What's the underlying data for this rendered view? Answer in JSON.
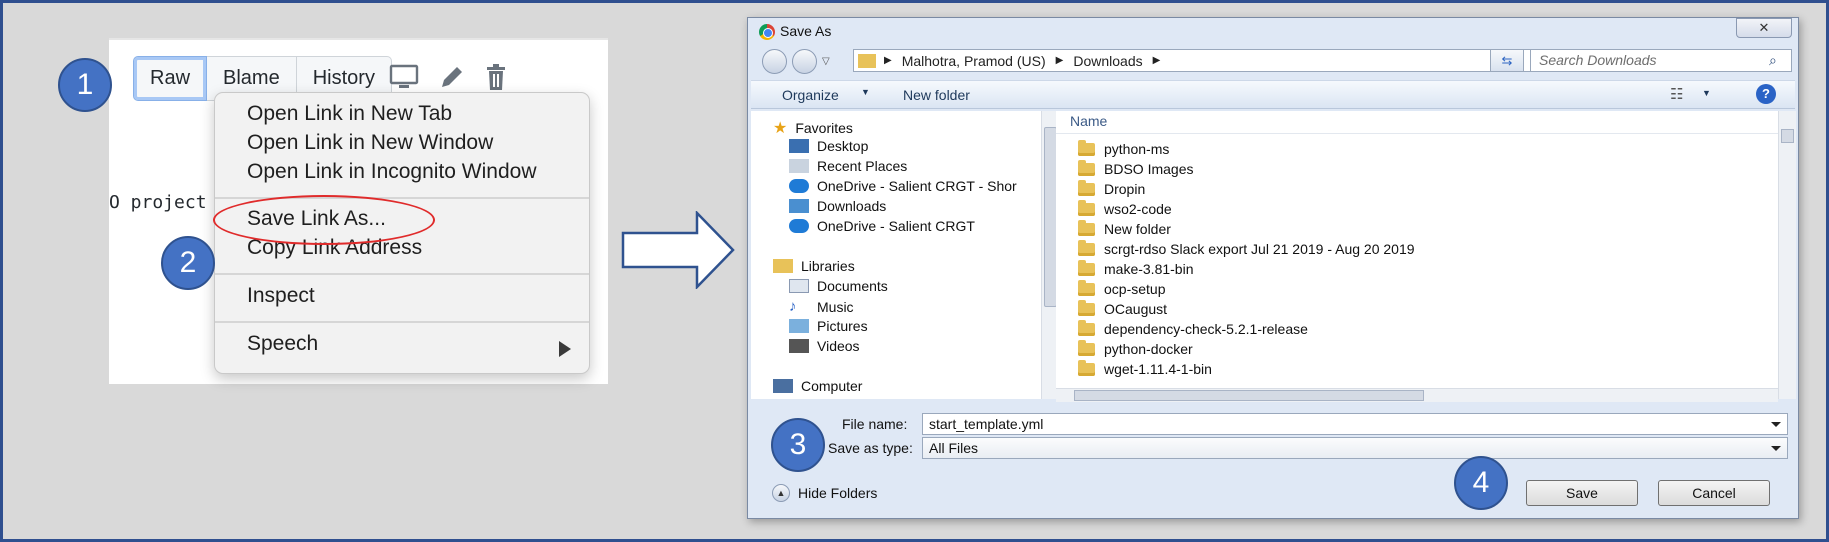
{
  "github": {
    "buttons": [
      "Raw",
      "Blame",
      "History"
    ],
    "code_snippet": "O project"
  },
  "context_menu": {
    "items": [
      {
        "label": "Open Link in New Tab"
      },
      {
        "label": "Open Link in New Window"
      },
      {
        "label": "Open Link in Incognito Window"
      },
      {
        "label": "Save Link As..."
      },
      {
        "label": "Copy Link Address"
      },
      {
        "label": "Inspect"
      },
      {
        "label": "Speech"
      }
    ]
  },
  "steps": [
    "1",
    "2",
    "3",
    "4"
  ],
  "dialog": {
    "title": "Save As",
    "close_label": "✕",
    "breadcrumb": [
      "Malhotra, Pramod (US)",
      "Downloads"
    ],
    "search_placeholder": "Search Downloads",
    "toolbar": {
      "organize": "Organize",
      "new_folder": "New folder"
    },
    "nav": {
      "favorites": "Favorites",
      "favorites_items": [
        "Desktop",
        "Recent Places",
        "OneDrive - Salient CRGT - Shor",
        "Downloads",
        "OneDrive - Salient CRGT"
      ],
      "libraries": "Libraries",
      "libraries_items": [
        "Documents",
        "Music",
        "Pictures",
        "Videos"
      ],
      "computer": "Computer"
    },
    "files_header": "Name",
    "files": [
      "python-ms",
      "BDSO Images",
      "Dropin",
      "wso2-code",
      "New folder",
      "scrgt-rdso Slack export Jul 21 2019 - Aug 20 2019",
      "make-3.81-bin",
      "ocp-setup",
      "OCaugust",
      "dependency-check-5.2.1-release",
      "python-docker",
      "wget-1.11.4-1-bin"
    ],
    "file_name_label": "File name:",
    "file_name_value": "start_template.yml",
    "save_type_label": "Save as type:",
    "save_type_value": "All Files",
    "hide_folders": "Hide Folders",
    "save_button": "Save",
    "cancel_button": "Cancel"
  },
  "colors": {
    "badge": "#4472c4",
    "highlight": "#e02b2b",
    "dialog_bg": "#dfe8f5"
  }
}
